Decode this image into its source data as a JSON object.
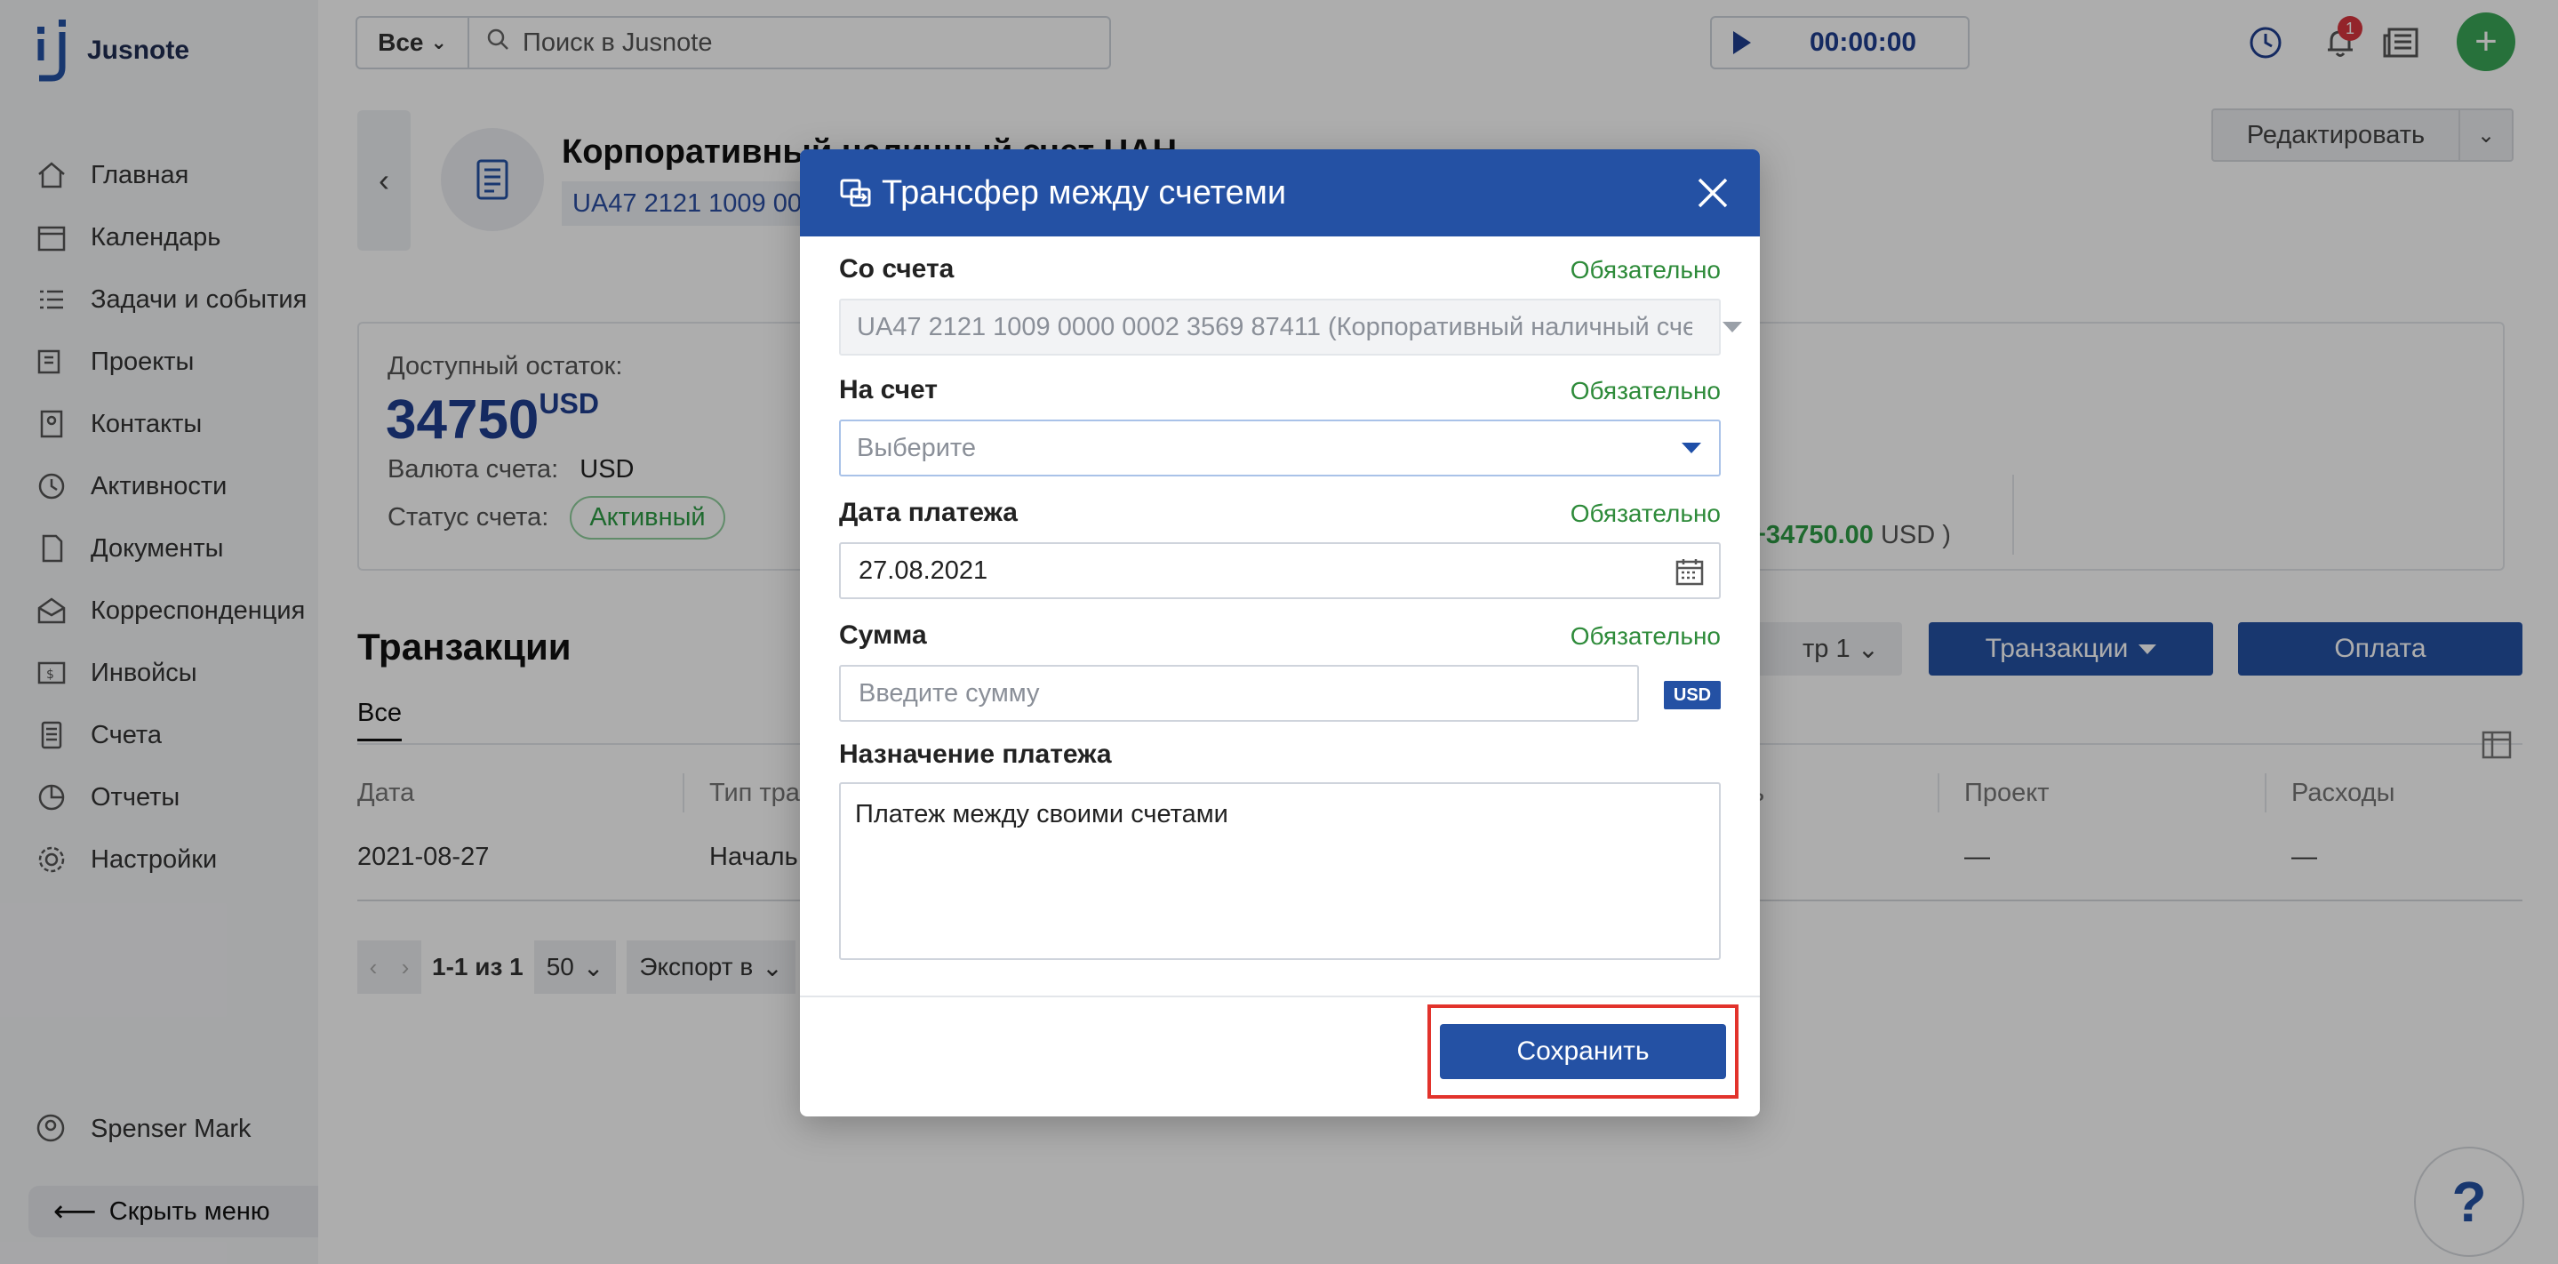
{
  "app": {
    "name": "Jusnote"
  },
  "sidebar": {
    "items": [
      {
        "label": "Главная",
        "icon": "home-icon"
      },
      {
        "label": "Календарь",
        "icon": "calendar-icon"
      },
      {
        "label": "Задачи и события",
        "icon": "tasks-icon"
      },
      {
        "label": "Проекты",
        "icon": "projects-icon"
      },
      {
        "label": "Контакты",
        "icon": "contacts-icon"
      },
      {
        "label": "Активности",
        "icon": "activity-icon"
      },
      {
        "label": "Документы",
        "icon": "documents-icon"
      },
      {
        "label": "Корреспонденция",
        "icon": "mail-icon"
      },
      {
        "label": "Инвойсы",
        "icon": "invoice-icon"
      },
      {
        "label": "Счета",
        "icon": "accounts-icon"
      },
      {
        "label": "Отчеты",
        "icon": "reports-icon"
      },
      {
        "label": "Настройки",
        "icon": "settings-icon"
      }
    ],
    "user": "Spenser Mark",
    "hide_menu": "Скрыть меню"
  },
  "topbar": {
    "scope": "Все",
    "search_placeholder": "Поиск в Jusnote",
    "timer": "00:00:00",
    "notifications_count": "1"
  },
  "account": {
    "title": "Корпоративный наличный счет UAH",
    "iban": "UA47 2121 1009 0000 0002 3569 87411",
    "edit_label": "Редактировать",
    "available_label": "Доступный остаток:",
    "available_value": "34750",
    "available_currency": "USD",
    "currency_label": "Валюта счета:",
    "currency_value": "USD",
    "status_label": "Статус счета:",
    "status_value": "Активный",
    "balance_amount": "+34750.00",
    "balance_currency": "USD"
  },
  "transactions": {
    "title": "Транзакции",
    "filter_label": "тр 1",
    "tx_button": "Транзакции",
    "pay_button": "Оплата",
    "tab_all": "Все",
    "columns": [
      "Дата",
      "Тип тра",
      "ь",
      "Проект",
      "Расходы"
    ],
    "rows": [
      {
        "date": "2021-08-27",
        "type": "Началь",
        "project": "—",
        "expense": "—"
      }
    ],
    "pager_range": "1-1 из 1",
    "page_size": "50",
    "export_label": "Экспорт в"
  },
  "modal": {
    "title": "Трансфер между счетеми",
    "required": "Обязательно",
    "from_label": "Со счета",
    "from_value": "UA47 2121 1009 0000 0002 3569 87411 (Корпоративный наличный сче...",
    "to_label": "На счет",
    "to_placeholder": "Выберите",
    "date_label": "Дата платежа",
    "date_value": "27.08.2021",
    "amount_label": "Сумма",
    "amount_placeholder": "Введите сумму",
    "amount_currency": "USD",
    "purpose_label": "Назначение платежа",
    "purpose_value": "Платеж между своими счетами",
    "save_label": "Сохранить"
  },
  "colors": {
    "primary": "#2451a4",
    "success": "#2e8b3a",
    "highlight": "#e2332c",
    "sidebar_bg": "#f4f5f7"
  }
}
